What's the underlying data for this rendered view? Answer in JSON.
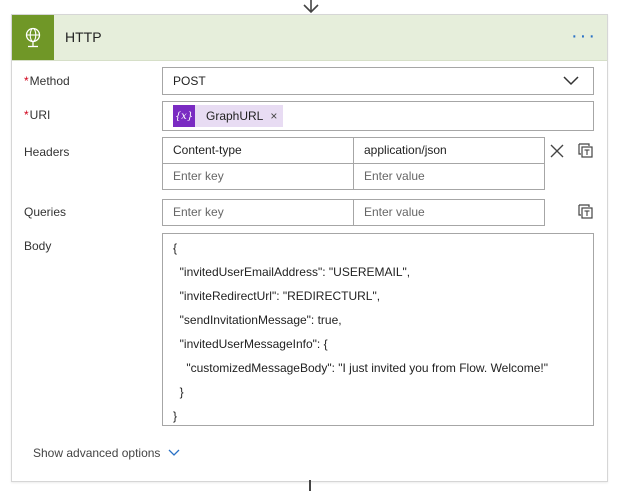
{
  "card": {
    "title": "HTTP",
    "more_label": "···"
  },
  "fields": {
    "method_label": "Method",
    "uri_label": "URI",
    "headers_label": "Headers",
    "queries_label": "Queries",
    "body_label": "Body",
    "required_mark": "*"
  },
  "method": {
    "value": "POST"
  },
  "uri": {
    "token_icon_text": "{x}",
    "token_label": "GraphURL",
    "token_close": "×"
  },
  "headers": {
    "rows": [
      {
        "key": "Content-type",
        "value": "application/json"
      }
    ],
    "key_placeholder": "Enter key",
    "value_placeholder": "Enter value"
  },
  "queries": {
    "key_placeholder": "Enter key",
    "value_placeholder": "Enter value"
  },
  "body": {
    "lines": [
      "{",
      "  \"invitedUserEmailAddress\": \"USEREMAIL\",",
      "  \"inviteRedirectUrl\": \"REDIRECTURL\",",
      "  \"sendInvitationMessage\": true,",
      "  \"invitedUserMessageInfo\": {",
      "    \"customizedMessageBody\": \"I just invited you from Flow. Welcome!\"",
      "  }",
      "}"
    ]
  },
  "advanced": {
    "label": "Show advanced options"
  },
  "colors": {
    "header_bg": "#e6eedb",
    "icon_bg": "#709727",
    "token_bg": "#e8dcf3",
    "token_icon_bg": "#7a2bc2",
    "more_color": "#2a71c6",
    "required_color": "#d0021b"
  },
  "icons": {
    "header": "globe-icon",
    "delete": "close-icon",
    "switch_mode": "switch-to-text-mode-icon",
    "chevron": "chevron-down-icon"
  }
}
